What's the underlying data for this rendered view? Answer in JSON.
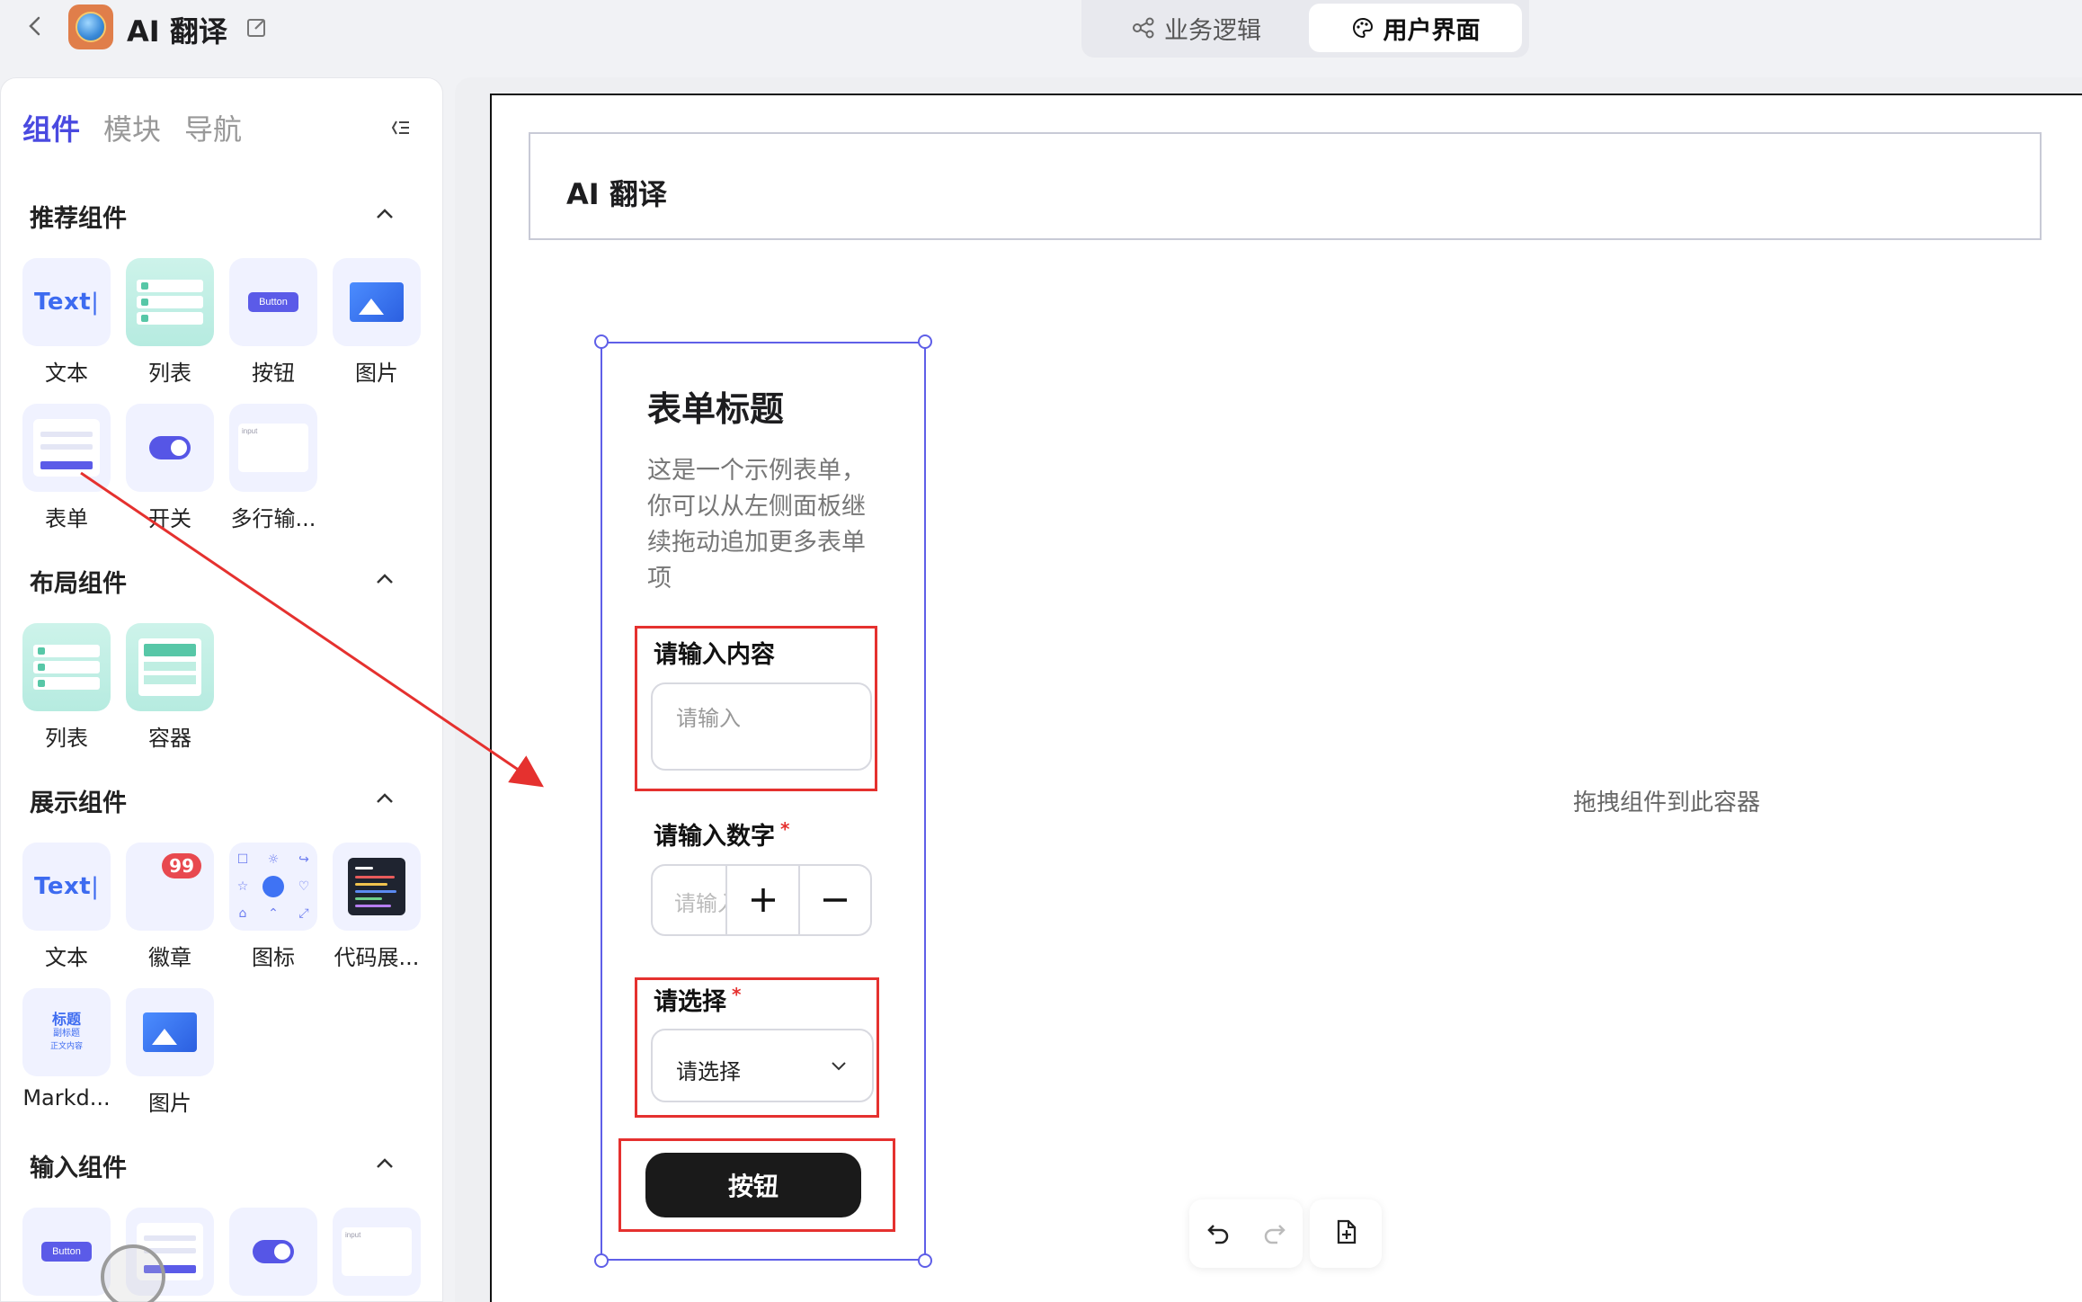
{
  "app": {
    "title": "AI 翻译"
  },
  "mode_switch": {
    "logic_label": "业务逻辑",
    "ui_label": "用户界面"
  },
  "sidebar": {
    "tabs": [
      "组件",
      "模块",
      "导航"
    ],
    "sections": [
      {
        "title": "推荐组件",
        "items": [
          "文本",
          "列表",
          "按钮",
          "图片",
          "表单",
          "开关",
          "多行输..."
        ]
      },
      {
        "title": "布局组件",
        "items": [
          "列表",
          "容器"
        ]
      },
      {
        "title": "展示组件",
        "items": [
          "文本",
          "徽章",
          "图标",
          "代码展...",
          "Markd...",
          "图片"
        ]
      },
      {
        "title": "输入组件",
        "items": []
      }
    ],
    "tile_text": {
      "text": "Text",
      "button": "Button",
      "input": "input",
      "badge": "99",
      "md_title": "标题",
      "md_sub1": "副标题",
      "md_sub2": "正文内容"
    }
  },
  "canvas": {
    "header_title": "AI 翻译",
    "drop_hint": "拖拽组件到此容器"
  },
  "form": {
    "title": "表单标题",
    "description": "这是一个示例表单，你可以从左侧面板继续拖动追加更多表单项",
    "field1": {
      "label": "请输入内容",
      "placeholder": "请输入"
    },
    "field2": {
      "label": "请输入数字",
      "required": "*",
      "placeholder": "请输入"
    },
    "field3": {
      "label": "请选择",
      "required": "*",
      "value": "请选择"
    },
    "submit_label": "按钮"
  },
  "icons": [
    "back-icon",
    "edit-icon",
    "flow-icon",
    "palette-icon",
    "collapse-icon",
    "chevron-up-icon",
    "chevron-down-icon",
    "undo-icon",
    "redo-icon",
    "add-file-icon"
  ],
  "colors": {
    "accent": "#5f5fe8",
    "highlight": "#e5312f",
    "button": "#1a1a1a"
  }
}
